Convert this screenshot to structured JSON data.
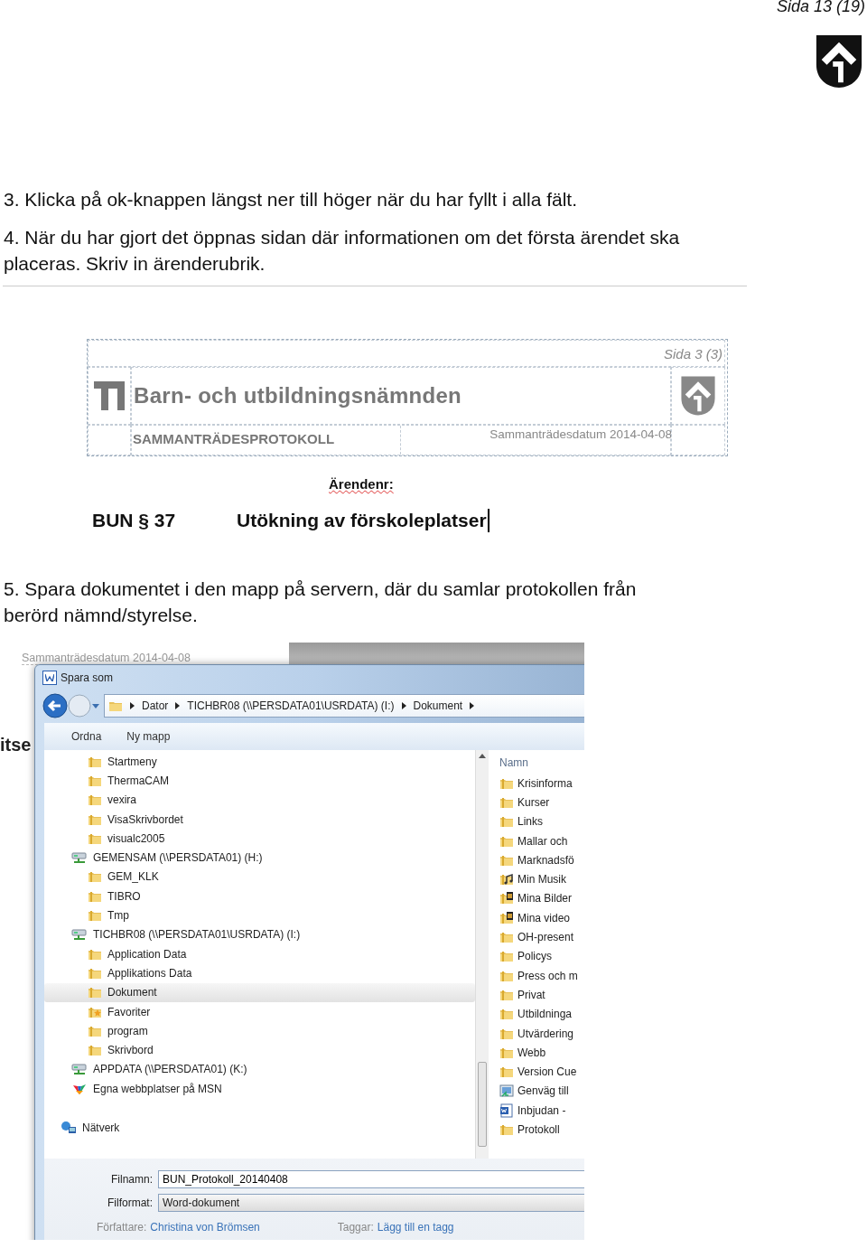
{
  "page_number": "Sida 13 (19)",
  "steps": [
    {
      "text": "3. Klicka på ok-knappen längst ner till höger när du har fyllt i alla fält."
    },
    {
      "text": "4. När du har gjort det öppnas sidan där informationen om det första ärendet ska placeras. Skriv in ärenderubrik."
    }
  ],
  "screenshot_1": {
    "page_label": "Sida 3 (3)",
    "title": "Barn- och utbildningsnämnden",
    "subtitle": "SAMMANTRÄDESPROTOKOLL",
    "date": "Sammanträdesdatum 2014-04-08",
    "case_label": "Ärendenr:",
    "paragraph": "BUN § 37",
    "heading": "Utökning av förskoleplatser"
  },
  "step_5": {
    "text": "5. Spara dokumentet i den mapp på servern, där du samlar protokollen från berörd nämnd/styrelse."
  },
  "screenshot_2": {
    "background_date": "Sammanträdesdatum 2014-04-08",
    "background_fragment": "itse",
    "dialog": {
      "title": "Spara som",
      "path": [
        "Dator",
        "TICHBR08 (\\\\PERSDATA01\\USRDATA) (I:)",
        "Dokument"
      ],
      "toolbar": [
        "Ordna",
        "Ny mapp"
      ],
      "tree": [
        {
          "label": "Startmeny",
          "kind": "folder",
          "selected": false
        },
        {
          "label": "ThermaCAM",
          "kind": "folder",
          "selected": false
        },
        {
          "label": "vexira",
          "kind": "folder",
          "selected": false
        },
        {
          "label": "VisaSkrivbordet",
          "kind": "folder",
          "selected": false
        },
        {
          "label": "visualc2005",
          "kind": "folder",
          "selected": false
        },
        {
          "label": "GEMENSAM (\\\\PERSDATA01) (H:)",
          "kind": "drive",
          "selected": false,
          "children": [
            {
              "label": "GEM_KLK",
              "kind": "folder",
              "selected": false
            },
            {
              "label": "TIBRO",
              "kind": "folder",
              "selected": false
            },
            {
              "label": "Tmp",
              "kind": "folder",
              "selected": false
            }
          ]
        },
        {
          "label": "TICHBR08 (\\\\PERSDATA01\\USRDATA) (I:)",
          "kind": "drive",
          "selected": false,
          "children": [
            {
              "label": "Application Data",
              "kind": "folder",
              "selected": false
            },
            {
              "label": "Applikations Data",
              "kind": "folder",
              "selected": false
            },
            {
              "label": "Dokument",
              "kind": "folder",
              "selected": true
            },
            {
              "label": "Favoriter",
              "kind": "favorites",
              "selected": false
            },
            {
              "label": "program",
              "kind": "folder",
              "selected": false
            },
            {
              "label": "Skrivbord",
              "kind": "folder",
              "selected": false
            }
          ]
        },
        {
          "label": "APPDATA (\\\\PERSDATA01) (K:)",
          "kind": "drive",
          "selected": false
        },
        {
          "label": "Egna webbplatser på MSN",
          "kind": "msn",
          "selected": false
        },
        {
          "label": "Nätverk",
          "kind": "network",
          "selected": false
        }
      ],
      "column_header": "Namn",
      "files": [
        {
          "label": "Krisinforma",
          "kind": "folder"
        },
        {
          "label": "Kurser",
          "kind": "folder"
        },
        {
          "label": "Links",
          "kind": "folder"
        },
        {
          "label": "Mallar och",
          "kind": "folder"
        },
        {
          "label": "Marknadsfö",
          "kind": "folder"
        },
        {
          "label": "Min Musik",
          "kind": "music"
        },
        {
          "label": "Mina Bilder",
          "kind": "media"
        },
        {
          "label": "Mina video",
          "kind": "media"
        },
        {
          "label": "OH-present",
          "kind": "folder"
        },
        {
          "label": "Policys",
          "kind": "folder"
        },
        {
          "label": "Press och m",
          "kind": "folder"
        },
        {
          "label": "Privat",
          "kind": "folder"
        },
        {
          "label": "Utbildninga",
          "kind": "folder"
        },
        {
          "label": "Utvärdering",
          "kind": "folder"
        },
        {
          "label": "Webb",
          "kind": "folder"
        },
        {
          "label": "Version Cue",
          "kind": "folder"
        },
        {
          "label": "Genväg till",
          "kind": "shortcut"
        },
        {
          "label": "Inbjudan -",
          "kind": "word"
        },
        {
          "label": "Protokoll",
          "kind": "folder"
        }
      ],
      "filename_label": "Filnamn:",
      "filename": "BUN_Protokoll_20140408",
      "format_label": "Filformat:",
      "format": "Word-dokument",
      "author_label": "Författare:",
      "author": "Christina von Brömsen",
      "tags_label": "Taggar:",
      "tags": "Lägg till en tagg"
    }
  }
}
